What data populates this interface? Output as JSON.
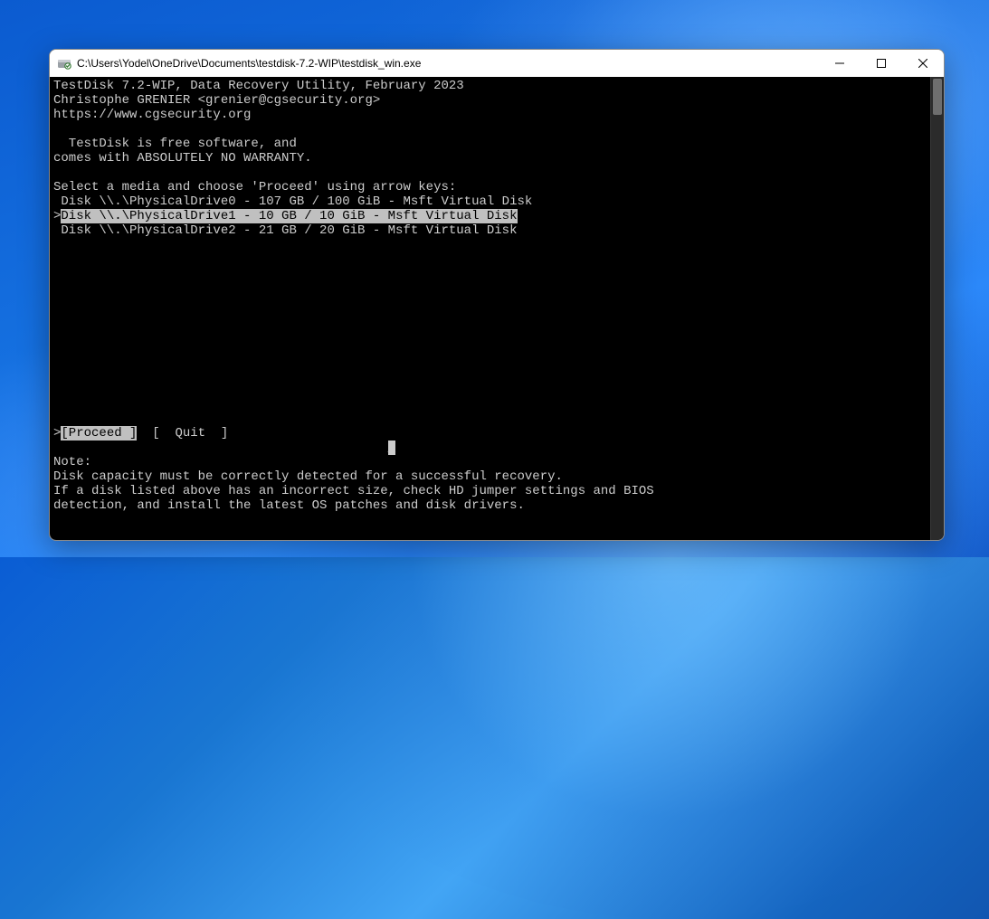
{
  "window": {
    "title": "C:\\Users\\Yodel\\OneDrive\\Documents\\testdisk-7.2-WIP\\testdisk_win.exe"
  },
  "header": {
    "line1": "TestDisk 7.2-WIP, Data Recovery Utility, February 2023",
    "line2": "Christophe GRENIER <grenier@cgsecurity.org>",
    "line3": "https://www.cgsecurity.org"
  },
  "info": {
    "line1": "  TestDisk is free software, and",
    "line2": "comes with ABSOLUTELY NO WARRANTY."
  },
  "prompt": "Select a media and choose 'Proceed' using arrow keys:",
  "disks": [
    {
      "text": " Disk \\\\.\\PhysicalDrive0 - 107 GB / 100 GiB - Msft Virtual Disk",
      "selected": false
    },
    {
      "text": "Disk \\\\.\\PhysicalDrive1 - 10 GB / 10 GiB - Msft Virtual Disk",
      "selected": true
    },
    {
      "text": " Disk \\\\.\\PhysicalDrive2 - 21 GB / 20 GiB - Msft Virtual Disk",
      "selected": false
    }
  ],
  "menu": {
    "proceed": "[Proceed ]",
    "quit": "[  Quit  ]"
  },
  "note": {
    "title": "Note:",
    "l1": "Disk capacity must be correctly detected for a successful recovery.",
    "l2": "If a disk listed above has an incorrect size, check HD jumper settings and BIOS",
    "l3": "detection, and install the latest OS patches and disk drivers."
  }
}
